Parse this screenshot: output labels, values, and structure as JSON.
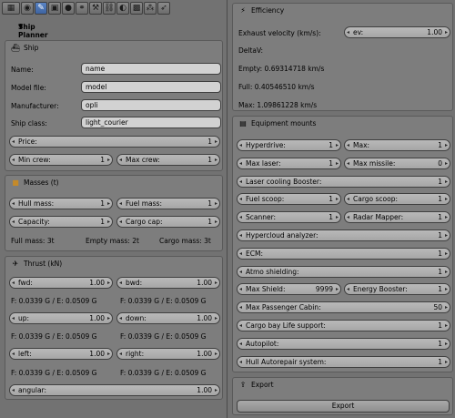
{
  "toolbar": {
    "icons": [
      "view-icon",
      "render-icon",
      "camera-icon",
      "object-icon",
      "world-icon",
      "link-icon",
      "wrench-icon",
      "constraint-icon",
      "material-icon",
      "texture-icon",
      "particles-icon",
      "physics-icon"
    ]
  },
  "planner": {
    "title": "Ship Planner"
  },
  "ship": {
    "title": "Ship",
    "name_label": "Name:",
    "name_value": "name",
    "model_label": "Model file:",
    "model_value": "model",
    "manufacturer_label": "Manufacturer:",
    "manufacturer_value": "opli",
    "class_label": "Ship class:",
    "class_value": "light_courier",
    "price_label": "Price:",
    "price_value": "1",
    "min_crew_label": "Min crew:",
    "min_crew_value": "1",
    "max_crew_label": "Max crew:",
    "max_crew_value": "1"
  },
  "masses": {
    "title": "Masses (t)",
    "hull_label": "Hull mass:",
    "hull_value": "1",
    "fuel_label": "Fuel mass:",
    "fuel_value": "1",
    "capacity_label": "Capacity:",
    "capacity_value": "1",
    "cargo_label": "Cargo cap:",
    "cargo_value": "1",
    "full_mass": "Full mass: 3t",
    "empty_mass": "Empty mass: 2t",
    "cargo_mass": "Cargo mass: 3t"
  },
  "thrust": {
    "title": "Thrust (kN)",
    "fwd_label": "fwd:",
    "fwd_value": "1.00",
    "bwd_label": "bwd:",
    "bwd_value": "1.00",
    "up_label": "up:",
    "up_value": "1.00",
    "down_label": "down:",
    "down_value": "1.00",
    "left_label": "left:",
    "left_value": "1.00",
    "right_label": "right:",
    "right_value": "1.00",
    "angular_label": "angular:",
    "angular_value": "1.00",
    "force_text": "F: 0.0339 G / E: 0.0509 G"
  },
  "efficiency": {
    "title": "Efficiency",
    "exhaust_label": "Exhaust velocity (km/s):",
    "ev_label": "ev:",
    "ev_value": "1.00",
    "deltav": "DeltaV:",
    "empty": "Empty: 0.69314718 km/s",
    "full": "Full: 0.40546510 km/s",
    "max": "Max: 1.09861228 km/s"
  },
  "equipment": {
    "title": "Equipment mounts",
    "rows": [
      {
        "a_label": "Hyperdrive:",
        "a_value": "1",
        "b_label": "Max:",
        "b_value": "1"
      },
      {
        "a_label": "Max laser:",
        "a_value": "1",
        "b_label": "Max missile:",
        "b_value": "0"
      },
      {
        "a_label": "Laser cooling Booster:",
        "a_value": "1"
      },
      {
        "a_label": "Fuel scoop:",
        "a_value": "1",
        "b_label": "Cargo scoop:",
        "b_value": "1"
      },
      {
        "a_label": "Scanner:",
        "a_value": "1",
        "b_label": "Radar Mapper:",
        "b_value": "1"
      },
      {
        "a_label": "Hypercloud analyzer:",
        "a_value": "1"
      },
      {
        "a_label": "ECM:",
        "a_value": "1"
      },
      {
        "a_label": "Atmo shielding:",
        "a_value": "1"
      },
      {
        "a_label": "Max Shield:",
        "a_value": "9999",
        "b_label": "Energy Booster:",
        "b_value": "1"
      },
      {
        "a_label": "Max Passenger Cabin:",
        "a_value": "50"
      },
      {
        "a_label": "Cargo bay Life support:",
        "a_value": "1"
      },
      {
        "a_label": "Autopilot:",
        "a_value": "1"
      },
      {
        "a_label": "Hull Autorepair system:",
        "a_value": "1"
      }
    ]
  },
  "export": {
    "title": "Export",
    "button_label": "Export"
  }
}
